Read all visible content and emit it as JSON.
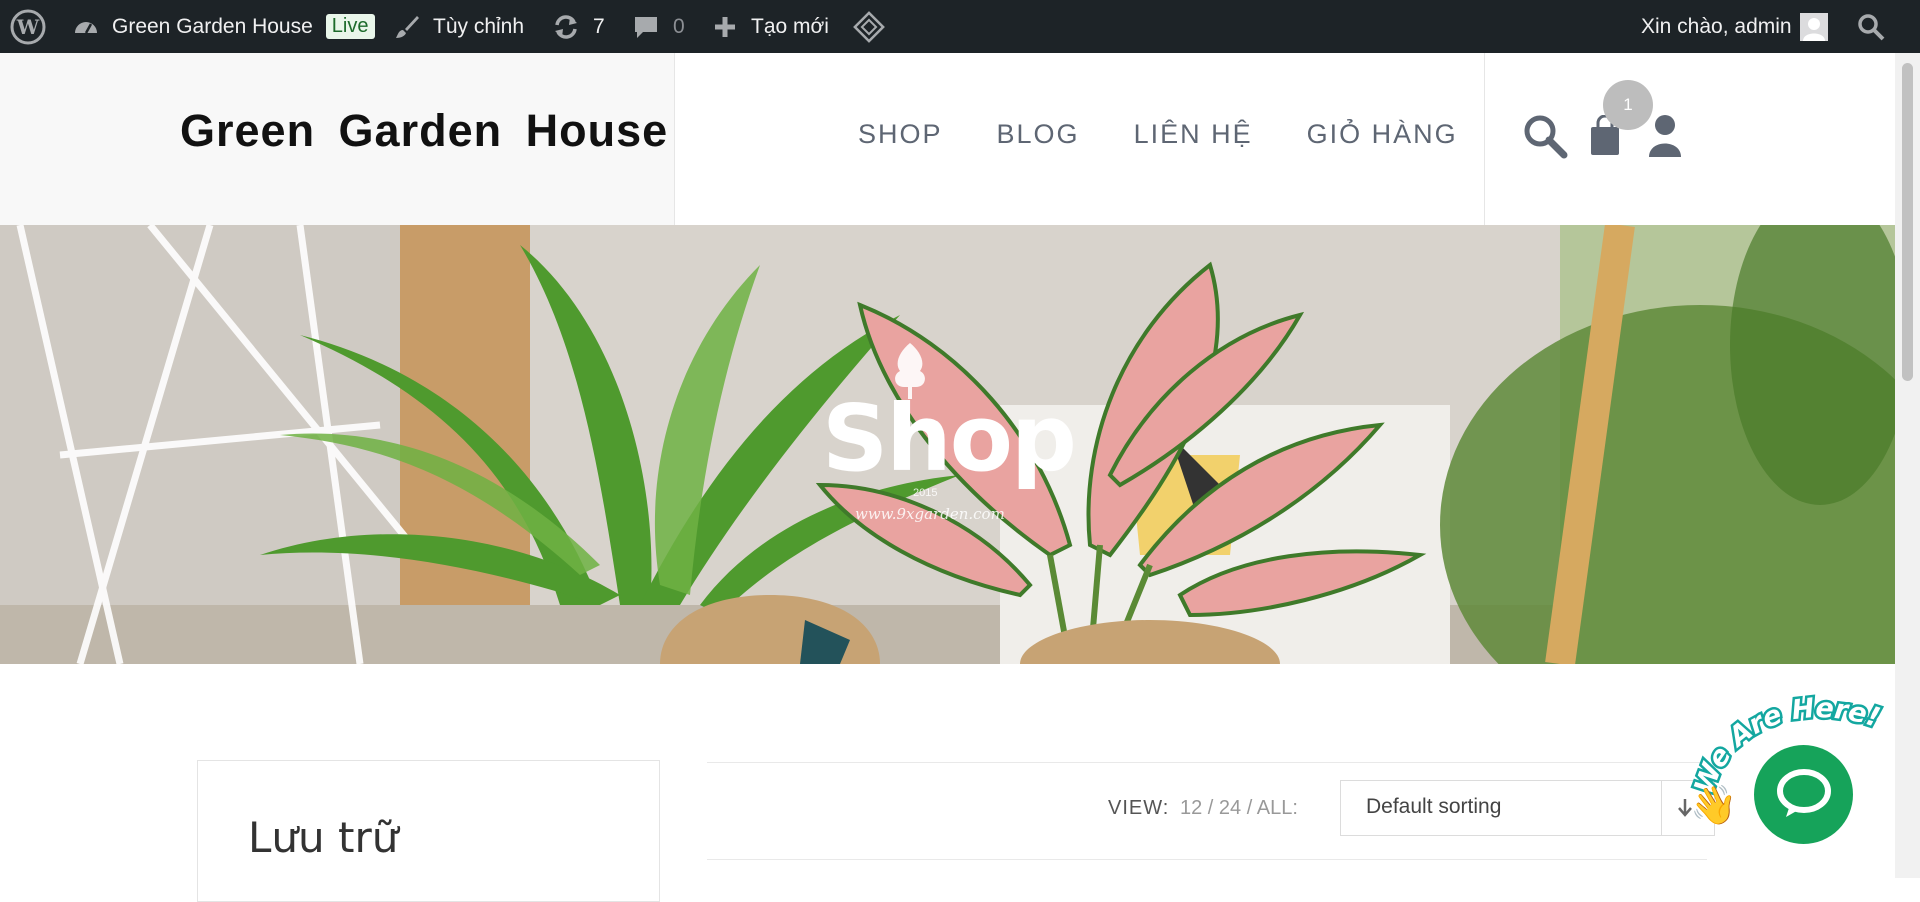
{
  "admin_bar": {
    "site_name": "Green Garden House",
    "live_badge": "Live",
    "customize": "Tùy chỉnh",
    "updates_count": "7",
    "comments_count": "0",
    "new": "Tạo mới",
    "greeting": "Xin chào, admin"
  },
  "header": {
    "site_title": "Green Garden House",
    "nav": [
      "SHOP",
      "BLOG",
      "LIÊN HỆ",
      "GIỎ HÀNG"
    ],
    "cart_count": "1"
  },
  "hero": {
    "title": "Shop",
    "watermark": "www.9xgarden.com",
    "watermark_year": "2015"
  },
  "sidebar": {
    "title": "Lưu trữ"
  },
  "toolbar": {
    "view_label": "VIEW:",
    "view_options": "12 / 24 / ALL:",
    "sort_selected": "Default sorting"
  },
  "chat_widget": {
    "tagline": "We Are Here!"
  },
  "colors": {
    "admin_bar": "#1d2327",
    "accent_green": "#16a35a",
    "nav_text": "#5e6673"
  }
}
